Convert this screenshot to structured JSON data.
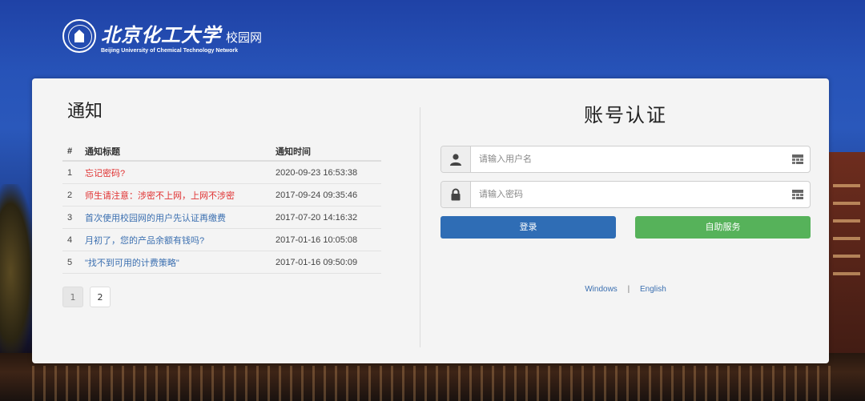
{
  "header": {
    "name": "北京化工大学",
    "suffix": "校园网",
    "english": "Beijing University of Chemical Technology Network"
  },
  "notice": {
    "title": "通知",
    "columns": [
      "#",
      "通知标题",
      "通知时间"
    ],
    "rows": [
      {
        "num": "1",
        "title": "忘记密码?",
        "time": "2020-09-23 16:53:38",
        "color": "#e03131"
      },
      {
        "num": "2",
        "title": "师生请注意：涉密不上网，上网不涉密",
        "time": "2017-09-24 09:35:46",
        "color": "#e03131"
      },
      {
        "num": "3",
        "title": "首次使用校园网的用户先认证再缴费",
        "time": "2017-07-20 14:16:32",
        "color": "#3b6fb0"
      },
      {
        "num": "4",
        "title": "月初了，您的产品余额有钱吗?",
        "time": "2017-01-16 10:05:08",
        "color": "#3b6fb0"
      },
      {
        "num": "5",
        "title": "\"找不到可用的计费策略\"",
        "time": "2017-01-16 09:50:09",
        "color": "#3b6fb0"
      }
    ],
    "pages": [
      "1",
      "2"
    ],
    "current_page": "1"
  },
  "login": {
    "title": "账号认证",
    "username_placeholder": "请输入用户名",
    "password_placeholder": "请输入密码",
    "login_label": "登录",
    "self_service_label": "自助服务",
    "windows_label": "Windows",
    "separator": "|",
    "english_label": "English"
  },
  "colors": {
    "login_button": "#2f6db5",
    "self_service_button": "#56b25a",
    "alert_red": "#e03131",
    "link_blue": "#3b6fb0"
  },
  "icons": {
    "seal": "university-seal-icon",
    "user": "user-icon",
    "lock": "lock-icon",
    "keypad": "keyboard-icon"
  }
}
